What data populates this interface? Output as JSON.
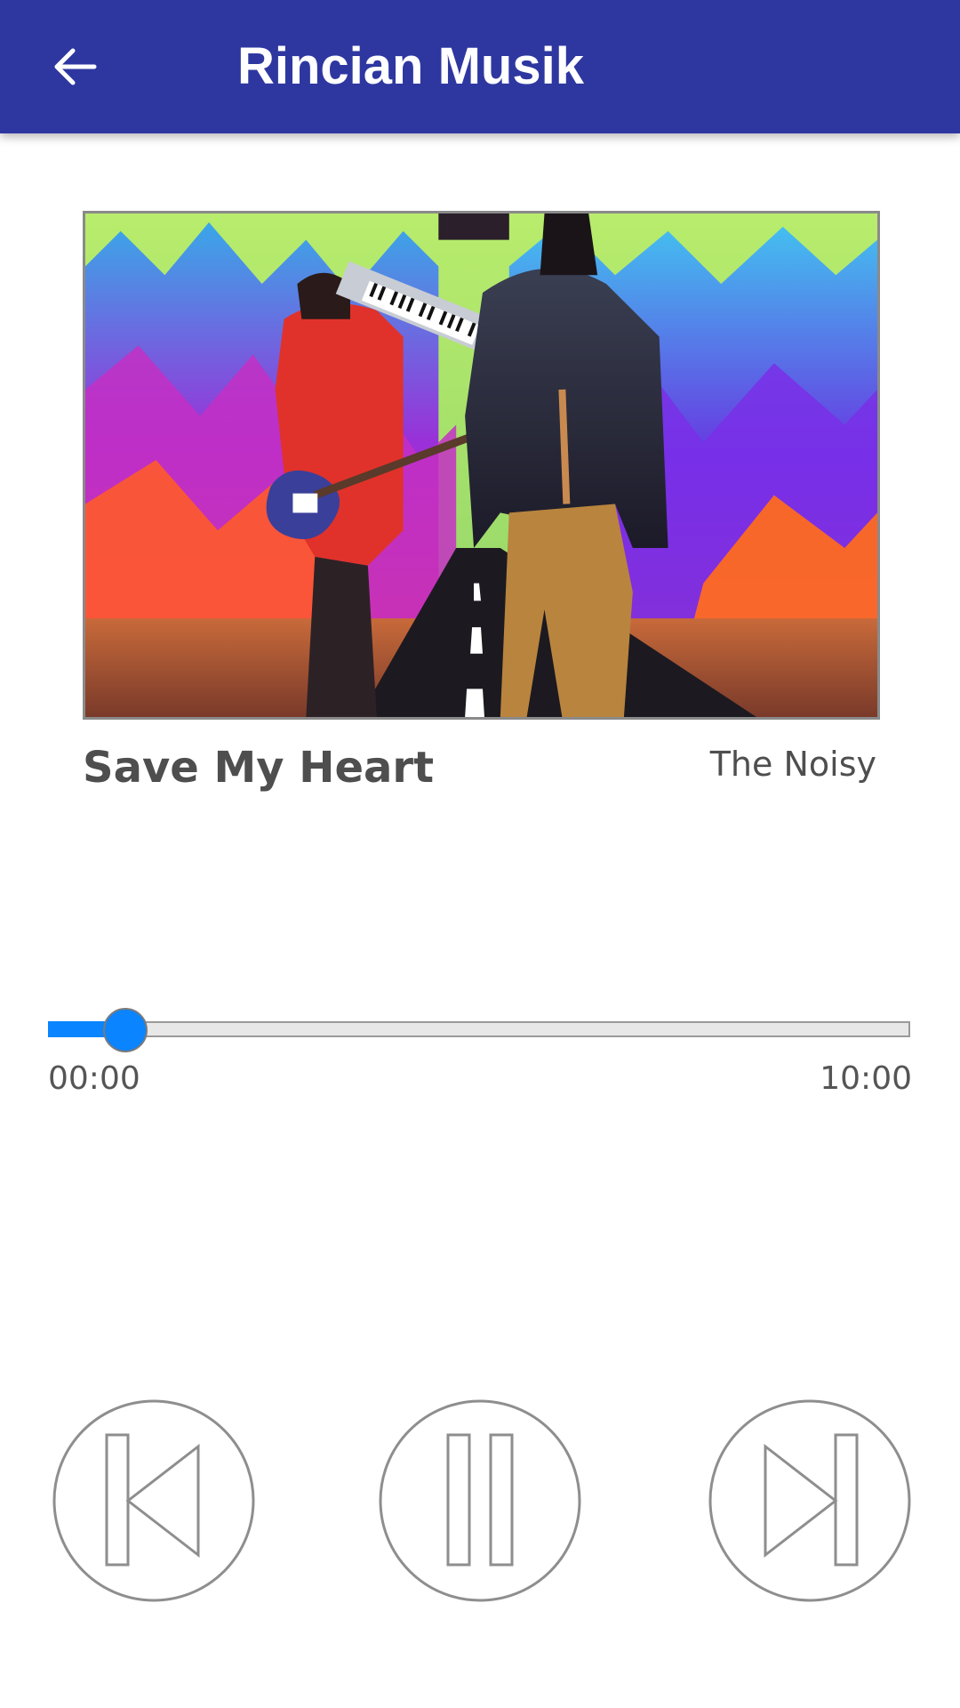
{
  "toolbar": {
    "title": "Rincian Musik",
    "back_icon": "arrow-back-icon",
    "background": "#2e37a0"
  },
  "track": {
    "title": "Save My Heart",
    "artist": "The Noisy",
    "cover_description_icon": "album-cover-image"
  },
  "player": {
    "current_time": "00:00",
    "total_time": "10:00",
    "progress": 0.09,
    "accent": "#0a84ff"
  },
  "controls": {
    "previous_icon": "skip-previous-icon",
    "pause_icon": "pause-icon",
    "next_icon": "skip-next-icon"
  }
}
